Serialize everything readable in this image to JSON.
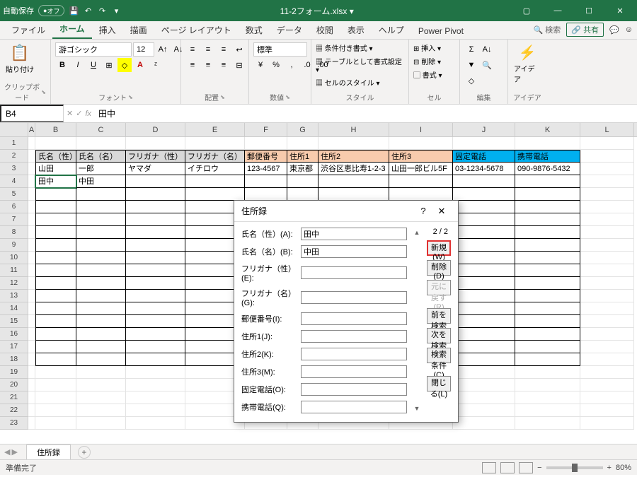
{
  "titlebar": {
    "autoSave": "自動保存",
    "off": "オフ",
    "filename": "11-2フォーム.xlsx ▾"
  },
  "tabs": {
    "file": "ファイル",
    "home": "ホーム",
    "insert": "挿入",
    "draw": "描画",
    "layout": "ページ レイアウト",
    "formulas": "数式",
    "data": "データ",
    "review": "校閲",
    "view": "表示",
    "help": "ヘルプ",
    "powerpivot": "Power Pivot",
    "search": "検索",
    "share": "共有"
  },
  "ribbon": {
    "clipboard": {
      "paste": "貼り付け",
      "label": "クリップボード"
    },
    "font": {
      "name": "游ゴシック",
      "size": "12",
      "label": "フォント"
    },
    "align": {
      "label": "配置"
    },
    "number": {
      "format": "標準",
      "label": "数値"
    },
    "styles": {
      "cond": "条件付き書式 ▾",
      "table": "テーブルとして書式設定 ▾",
      "cell": "セルのスタイル ▾",
      "label": "スタイル"
    },
    "cells": {
      "insert": "挿入 ▾",
      "delete": "削除 ▾",
      "format": "書式 ▾",
      "label": "セル"
    },
    "editing": {
      "label": "編集"
    },
    "ideas": {
      "ideas": "アイデア",
      "label": "アイデア"
    }
  },
  "fbar": {
    "name": "B4",
    "formula": "田中"
  },
  "cols": [
    "A",
    "B",
    "C",
    "D",
    "E",
    "F",
    "G",
    "H",
    "I",
    "J",
    "K",
    "L"
  ],
  "headers": {
    "B": "氏名（性）",
    "C": "氏名（名）",
    "D": "フリガナ（性）",
    "E": "フリガナ（名）",
    "F": "郵便番号",
    "G": "住所1",
    "H": "住所2",
    "I": "住所3",
    "J": "固定電話",
    "K": "携帯電話"
  },
  "row3": {
    "B": "山田",
    "C": "一郎",
    "D": "ヤマダ",
    "E": "イチロウ",
    "F": "123-4567",
    "G": "東京都",
    "H": "渋谷区恵比寿1-2-3",
    "I": "山田一郎ビル5F",
    "J": "03-1234-5678",
    "K": "090-9876-5432"
  },
  "row4": {
    "B": "田中",
    "C": "中田"
  },
  "dialog": {
    "title": "住所録",
    "counter": "2 / 2",
    "fields": {
      "sei": "氏名（性）(A):",
      "mei": "氏名（名）(B):",
      "fsei": "フリガナ（性）(E):",
      "fmei": "フリガナ（名）(G):",
      "zip": "郵便番号(I):",
      "addr1": "住所1(J):",
      "addr2": "住所2(K):",
      "addr3": "住所3(M):",
      "tel": "固定電話(O):",
      "mob": "携帯電話(Q):"
    },
    "values": {
      "sei": "田中",
      "mei": "中田"
    },
    "buttons": {
      "new": "新規(W)",
      "delete": "削除(D)",
      "restore": "元に戻す(R)",
      "prev": "前を検索(P)",
      "next": "次を検索(N)",
      "criteria": "検索条件(C)",
      "close": "閉じる(L)"
    }
  },
  "sheet": {
    "name": "住所録"
  },
  "status": {
    "ready": "準備完了",
    "zoomMinus": "−",
    "zoomPlus": "+",
    "zoom": "80%"
  }
}
